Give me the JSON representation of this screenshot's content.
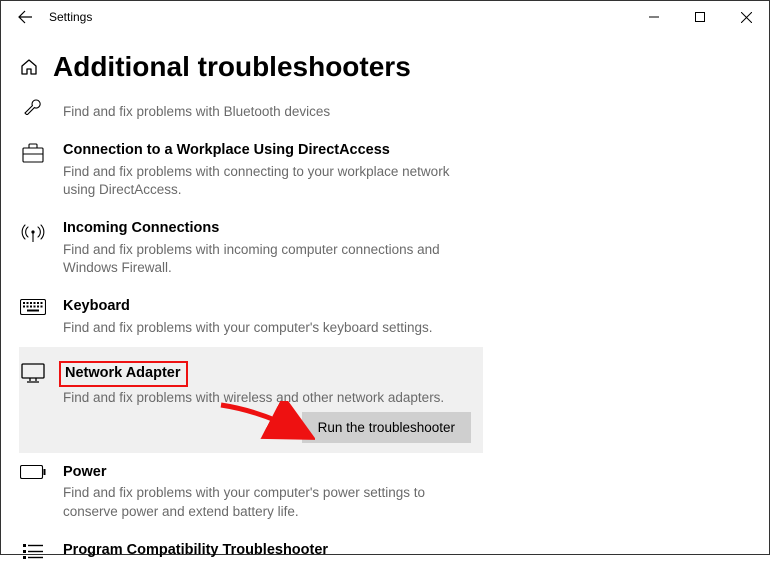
{
  "window": {
    "title": "Settings"
  },
  "page": {
    "heading": "Additional troubleshooters"
  },
  "items": {
    "bluetooth": {
      "desc": "Find and fix problems with Bluetooth devices"
    },
    "directaccess": {
      "title": "Connection to a Workplace Using DirectAccess",
      "desc": "Find and fix problems with connecting to your workplace network using DirectAccess."
    },
    "incoming": {
      "title": "Incoming Connections",
      "desc": "Find and fix problems with incoming computer connections and Windows Firewall."
    },
    "keyboard": {
      "title": "Keyboard",
      "desc": "Find and fix problems with your computer's keyboard settings."
    },
    "network_adapter": {
      "title": "Network Adapter",
      "desc": "Find and fix problems with wireless and other network adapters.",
      "button": "Run the troubleshooter"
    },
    "power": {
      "title": "Power",
      "desc": "Find and fix problems with your computer's power settings to conserve power and extend battery life."
    },
    "compat": {
      "title": "Program Compatibility Troubleshooter"
    }
  }
}
